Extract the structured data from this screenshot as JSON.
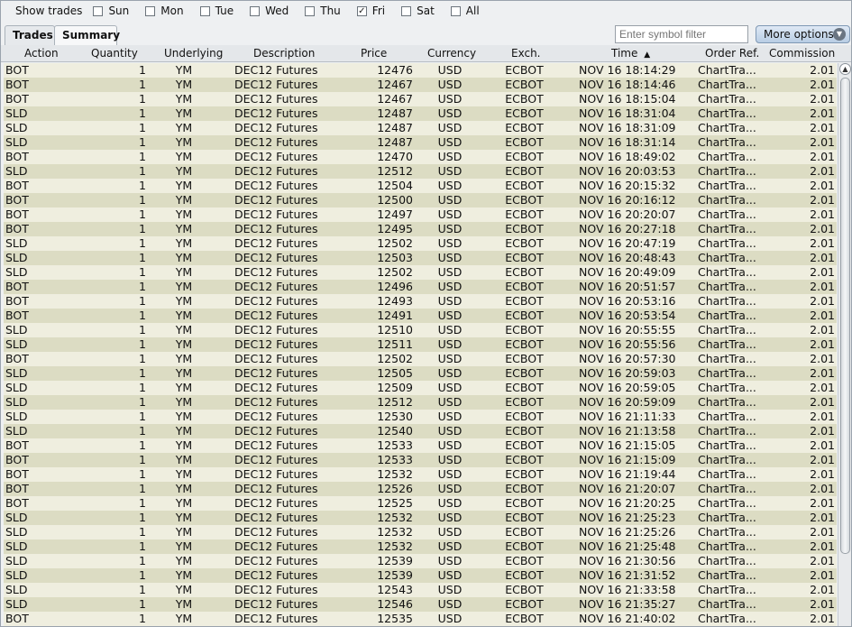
{
  "daybar": {
    "title": "Show trades",
    "days": [
      {
        "label": "Sun",
        "checked": false
      },
      {
        "label": "Mon",
        "checked": false
      },
      {
        "label": "Tue",
        "checked": false
      },
      {
        "label": "Wed",
        "checked": false
      },
      {
        "label": "Thu",
        "checked": false
      },
      {
        "label": "Fri",
        "checked": true
      },
      {
        "label": "Sat",
        "checked": false
      },
      {
        "label": "All",
        "checked": false
      }
    ]
  },
  "tabs": [
    {
      "label": "Trades"
    },
    {
      "label": "Summary"
    }
  ],
  "filter": {
    "placeholder": "Enter symbol filter"
  },
  "more_options": {
    "label": "More options"
  },
  "columns": [
    "Action",
    "Quantity",
    "Underlying",
    "Description",
    "Price",
    "Currency",
    "Exch.",
    "Time",
    "Order Ref.",
    "Commission"
  ],
  "sort_icon": "sort-ascending-icon",
  "rows": [
    [
      "BOT",
      "1",
      "YM",
      "DEC12 Futures",
      "12476",
      "USD",
      "ECBOT",
      "NOV 16 18:14:29",
      "ChartTra...",
      "2.01"
    ],
    [
      "BOT",
      "1",
      "YM",
      "DEC12 Futures",
      "12467",
      "USD",
      "ECBOT",
      "NOV 16 18:14:46",
      "ChartTra...",
      "2.01"
    ],
    [
      "BOT",
      "1",
      "YM",
      "DEC12 Futures",
      "12467",
      "USD",
      "ECBOT",
      "NOV 16 18:15:04",
      "ChartTra...",
      "2.01"
    ],
    [
      "SLD",
      "1",
      "YM",
      "DEC12 Futures",
      "12487",
      "USD",
      "ECBOT",
      "NOV 16 18:31:04",
      "ChartTra...",
      "2.01"
    ],
    [
      "SLD",
      "1",
      "YM",
      "DEC12 Futures",
      "12487",
      "USD",
      "ECBOT",
      "NOV 16 18:31:09",
      "ChartTra...",
      "2.01"
    ],
    [
      "SLD",
      "1",
      "YM",
      "DEC12 Futures",
      "12487",
      "USD",
      "ECBOT",
      "NOV 16 18:31:14",
      "ChartTra...",
      "2.01"
    ],
    [
      "BOT",
      "1",
      "YM",
      "DEC12 Futures",
      "12470",
      "USD",
      "ECBOT",
      "NOV 16 18:49:02",
      "ChartTra...",
      "2.01"
    ],
    [
      "SLD",
      "1",
      "YM",
      "DEC12 Futures",
      "12512",
      "USD",
      "ECBOT",
      "NOV 16 20:03:53",
      "ChartTra...",
      "2.01"
    ],
    [
      "BOT",
      "1",
      "YM",
      "DEC12 Futures",
      "12504",
      "USD",
      "ECBOT",
      "NOV 16 20:15:32",
      "ChartTra...",
      "2.01"
    ],
    [
      "BOT",
      "1",
      "YM",
      "DEC12 Futures",
      "12500",
      "USD",
      "ECBOT",
      "NOV 16 20:16:12",
      "ChartTra...",
      "2.01"
    ],
    [
      "BOT",
      "1",
      "YM",
      "DEC12 Futures",
      "12497",
      "USD",
      "ECBOT",
      "NOV 16 20:20:07",
      "ChartTra...",
      "2.01"
    ],
    [
      "BOT",
      "1",
      "YM",
      "DEC12 Futures",
      "12495",
      "USD",
      "ECBOT",
      "NOV 16 20:27:18",
      "ChartTra...",
      "2.01"
    ],
    [
      "SLD",
      "1",
      "YM",
      "DEC12 Futures",
      "12502",
      "USD",
      "ECBOT",
      "NOV 16 20:47:19",
      "ChartTra...",
      "2.01"
    ],
    [
      "SLD",
      "1",
      "YM",
      "DEC12 Futures",
      "12503",
      "USD",
      "ECBOT",
      "NOV 16 20:48:43",
      "ChartTra...",
      "2.01"
    ],
    [
      "SLD",
      "1",
      "YM",
      "DEC12 Futures",
      "12502",
      "USD",
      "ECBOT",
      "NOV 16 20:49:09",
      "ChartTra...",
      "2.01"
    ],
    [
      "BOT",
      "1",
      "YM",
      "DEC12 Futures",
      "12496",
      "USD",
      "ECBOT",
      "NOV 16 20:51:57",
      "ChartTra...",
      "2.01"
    ],
    [
      "BOT",
      "1",
      "YM",
      "DEC12 Futures",
      "12493",
      "USD",
      "ECBOT",
      "NOV 16 20:53:16",
      "ChartTra...",
      "2.01"
    ],
    [
      "BOT",
      "1",
      "YM",
      "DEC12 Futures",
      "12491",
      "USD",
      "ECBOT",
      "NOV 16 20:53:54",
      "ChartTra...",
      "2.01"
    ],
    [
      "SLD",
      "1",
      "YM",
      "DEC12 Futures",
      "12510",
      "USD",
      "ECBOT",
      "NOV 16 20:55:55",
      "ChartTra...",
      "2.01"
    ],
    [
      "SLD",
      "1",
      "YM",
      "DEC12 Futures",
      "12511",
      "USD",
      "ECBOT",
      "NOV 16 20:55:56",
      "ChartTra...",
      "2.01"
    ],
    [
      "BOT",
      "1",
      "YM",
      "DEC12 Futures",
      "12502",
      "USD",
      "ECBOT",
      "NOV 16 20:57:30",
      "ChartTra...",
      "2.01"
    ],
    [
      "SLD",
      "1",
      "YM",
      "DEC12 Futures",
      "12505",
      "USD",
      "ECBOT",
      "NOV 16 20:59:03",
      "ChartTra...",
      "2.01"
    ],
    [
      "SLD",
      "1",
      "YM",
      "DEC12 Futures",
      "12509",
      "USD",
      "ECBOT",
      "NOV 16 20:59:05",
      "ChartTra...",
      "2.01"
    ],
    [
      "SLD",
      "1",
      "YM",
      "DEC12 Futures",
      "12512",
      "USD",
      "ECBOT",
      "NOV 16 20:59:09",
      "ChartTra...",
      "2.01"
    ],
    [
      "SLD",
      "1",
      "YM",
      "DEC12 Futures",
      "12530",
      "USD",
      "ECBOT",
      "NOV 16 21:11:33",
      "ChartTra...",
      "2.01"
    ],
    [
      "SLD",
      "1",
      "YM",
      "DEC12 Futures",
      "12540",
      "USD",
      "ECBOT",
      "NOV 16 21:13:58",
      "ChartTra...",
      "2.01"
    ],
    [
      "BOT",
      "1",
      "YM",
      "DEC12 Futures",
      "12533",
      "USD",
      "ECBOT",
      "NOV 16 21:15:05",
      "ChartTra...",
      "2.01"
    ],
    [
      "BOT",
      "1",
      "YM",
      "DEC12 Futures",
      "12533",
      "USD",
      "ECBOT",
      "NOV 16 21:15:09",
      "ChartTra...",
      "2.01"
    ],
    [
      "BOT",
      "1",
      "YM",
      "DEC12 Futures",
      "12532",
      "USD",
      "ECBOT",
      "NOV 16 21:19:44",
      "ChartTra...",
      "2.01"
    ],
    [
      "BOT",
      "1",
      "YM",
      "DEC12 Futures",
      "12526",
      "USD",
      "ECBOT",
      "NOV 16 21:20:07",
      "ChartTra...",
      "2.01"
    ],
    [
      "BOT",
      "1",
      "YM",
      "DEC12 Futures",
      "12525",
      "USD",
      "ECBOT",
      "NOV 16 21:20:25",
      "ChartTra...",
      "2.01"
    ],
    [
      "SLD",
      "1",
      "YM",
      "DEC12 Futures",
      "12532",
      "USD",
      "ECBOT",
      "NOV 16 21:25:23",
      "ChartTra...",
      "2.01"
    ],
    [
      "SLD",
      "1",
      "YM",
      "DEC12 Futures",
      "12532",
      "USD",
      "ECBOT",
      "NOV 16 21:25:26",
      "ChartTra...",
      "2.01"
    ],
    [
      "SLD",
      "1",
      "YM",
      "DEC12 Futures",
      "12532",
      "USD",
      "ECBOT",
      "NOV 16 21:25:48",
      "ChartTra...",
      "2.01"
    ],
    [
      "SLD",
      "1",
      "YM",
      "DEC12 Futures",
      "12539",
      "USD",
      "ECBOT",
      "NOV 16 21:30:56",
      "ChartTra...",
      "2.01"
    ],
    [
      "SLD",
      "1",
      "YM",
      "DEC12 Futures",
      "12539",
      "USD",
      "ECBOT",
      "NOV 16 21:31:52",
      "ChartTra...",
      "2.01"
    ],
    [
      "SLD",
      "1",
      "YM",
      "DEC12 Futures",
      "12543",
      "USD",
      "ECBOT",
      "NOV 16 21:33:58",
      "ChartTra...",
      "2.01"
    ],
    [
      "SLD",
      "1",
      "YM",
      "DEC12 Futures",
      "12546",
      "USD",
      "ECBOT",
      "NOV 16 21:35:27",
      "ChartTra...",
      "2.01"
    ],
    [
      "BOT",
      "1",
      "YM",
      "DEC12 Futures",
      "12535",
      "USD",
      "ECBOT",
      "NOV 16 21:40:02",
      "ChartTra...",
      "2.01"
    ]
  ]
}
